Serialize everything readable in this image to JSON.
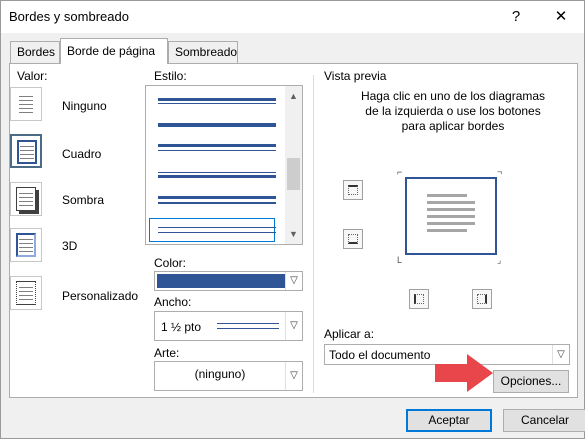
{
  "window": {
    "title": "Bordes y sombreado",
    "help_label": "?",
    "close_label": "✕"
  },
  "tabs": [
    {
      "label": "Bordes",
      "mnemonic": "B",
      "active": false
    },
    {
      "label": "Borde de página",
      "mnemonic": "p",
      "active": true
    },
    {
      "label": "Sombreado",
      "mnemonic": "S",
      "active": false
    }
  ],
  "setting": {
    "label": "Valor:",
    "options": [
      {
        "label": "Ninguno",
        "icon": "none-border-icon",
        "selected": false
      },
      {
        "label": "Cuadro",
        "icon": "box-border-icon",
        "selected": true
      },
      {
        "label": "Sombra",
        "icon": "shadow-border-icon",
        "selected": false
      },
      {
        "label": "3D",
        "icon": "3d-border-icon",
        "selected": false
      },
      {
        "label": "Personalizado",
        "icon": "custom-border-icon",
        "selected": false
      }
    ]
  },
  "style": {
    "label": "Estilo:",
    "selected_index": 6
  },
  "color": {
    "label": "Color:",
    "value_color": "#2f5597"
  },
  "width": {
    "label": "Ancho:",
    "value": "1 ½ pto"
  },
  "art": {
    "label": "Arte:",
    "value": "(ninguno)"
  },
  "preview": {
    "label": "Vista previa",
    "hint": "Haga clic en uno de los diagramas de la izquierda o use los botones para aplicar bordes"
  },
  "apply_to": {
    "label": "Aplicar a:",
    "value": "Todo el documento"
  },
  "buttons": {
    "options": "Opciones...",
    "ok": "Aceptar",
    "cancel": "Cancelar"
  },
  "colors": {
    "accent": "#2f5597",
    "arrow": "#e8464b",
    "default_button_border": "#0078d7"
  }
}
